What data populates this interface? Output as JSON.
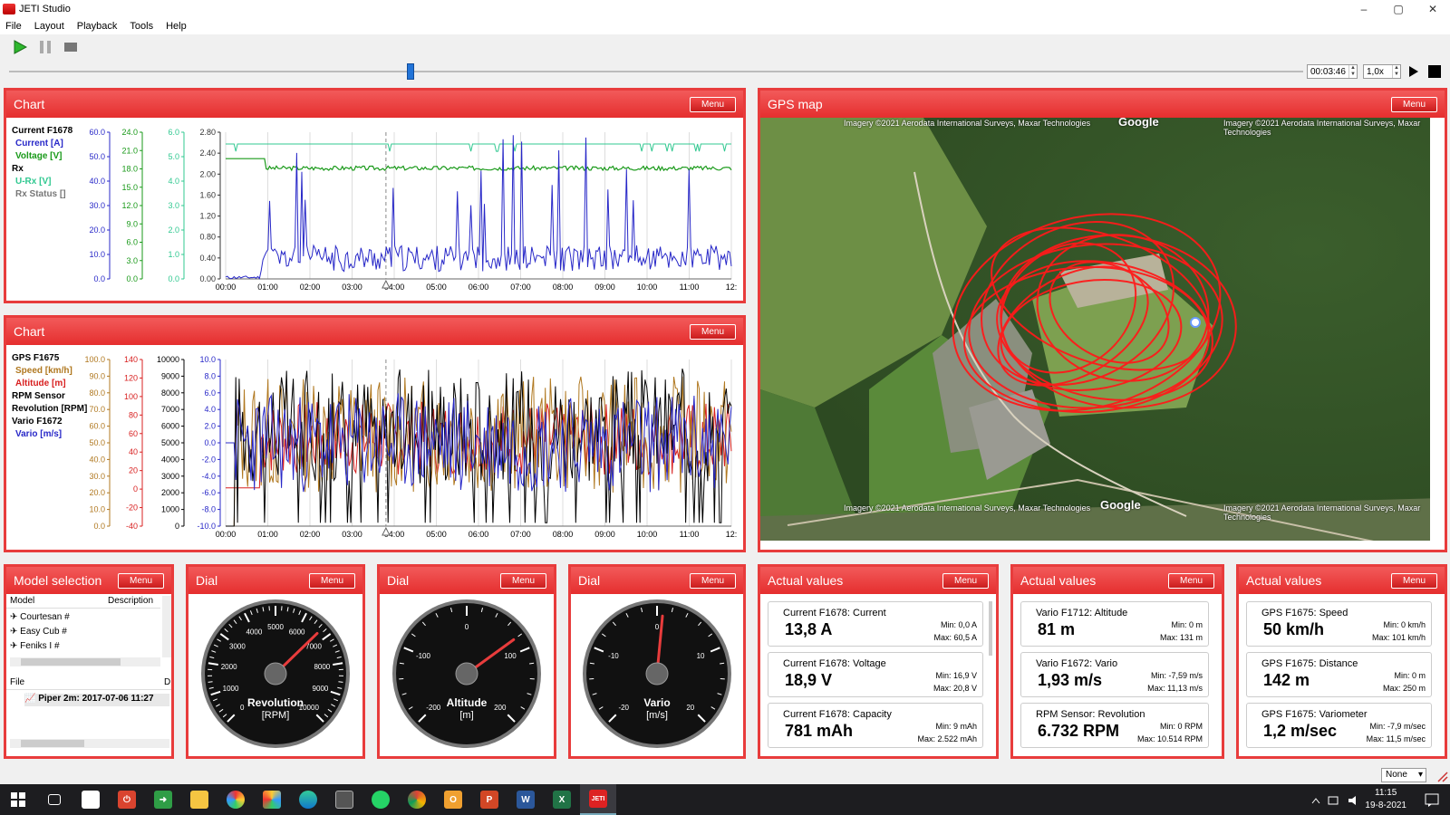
{
  "window": {
    "title": "JETI Studio",
    "min": "–",
    "max": "▢",
    "close": "✕"
  },
  "menu": [
    "File",
    "Layout",
    "Playback",
    "Tools",
    "Help"
  ],
  "playback": {
    "time": "00:03:46",
    "speed": "1,0x",
    "position": 0.31
  },
  "chart1": {
    "title": "Chart",
    "menu": "Menu",
    "legend": [
      {
        "text": "Current F1678",
        "color": "#000000"
      },
      {
        "text": "Current [A]",
        "color": "#2828c8"
      },
      {
        "text": "Voltage [V]",
        "color": "#1a9a1a"
      },
      {
        "text": "Rx",
        "color": "#000000"
      },
      {
        "text": "U-Rx [V]",
        "color": "#30c890"
      },
      {
        "text": "Rx Status []",
        "color": "#777777"
      }
    ],
    "axes": [
      {
        "ticks": [
          "60.0",
          "50.0",
          "40.0",
          "30.0",
          "20.0",
          "10.0",
          "0.0"
        ],
        "color": "#2828c8"
      },
      {
        "ticks": [
          "24.0",
          "21.0",
          "18.0",
          "15.0",
          "12.0",
          "9.0",
          "6.0",
          "3.0",
          "0.0"
        ],
        "color": "#1a9a1a"
      },
      {
        "ticks": [
          "6.0",
          "5.0",
          "4.0",
          "3.0",
          "2.0",
          "1.0",
          "0.0"
        ],
        "color": "#30c890"
      },
      {
        "ticks": [
          "2.80",
          "2.40",
          "2.00",
          "1.60",
          "1.20",
          "0.80",
          "0.40",
          "0.00"
        ],
        "color": "#333333"
      }
    ],
    "xticks": [
      "00:00",
      "01:00",
      "02:00",
      "03:00",
      "04:00",
      "05:00",
      "06:00",
      "07:00",
      "08:00",
      "09:00",
      "10:00",
      "11:00",
      "12:"
    ]
  },
  "chart2": {
    "title": "Chart",
    "menu": "Menu",
    "legend": [
      {
        "text": "GPS F1675",
        "color": "#000000"
      },
      {
        "text": "Speed [km/h]",
        "color": "#b07820"
      },
      {
        "text": "Altitude [m]",
        "color": "#d82020"
      },
      {
        "text": "RPM Sensor",
        "color": "#000000"
      },
      {
        "text": "Revolution [RPM]",
        "color": "#000000"
      },
      {
        "text": "Vario F1672",
        "color": "#000000"
      },
      {
        "text": "Vario [m/s]",
        "color": "#2828c8"
      }
    ],
    "axes": [
      {
        "ticks": [
          "100.0",
          "90.0",
          "80.0",
          "70.0",
          "60.0",
          "50.0",
          "40.0",
          "30.0",
          "20.0",
          "10.0",
          "0.0"
        ],
        "color": "#b07820"
      },
      {
        "ticks": [
          "140",
          "120",
          "100",
          "80",
          "60",
          "40",
          "20",
          "0",
          "-20",
          "-40"
        ],
        "color": "#d82020"
      },
      {
        "ticks": [
          "10000",
          "9000",
          "8000",
          "7000",
          "6000",
          "5000",
          "4000",
          "3000",
          "2000",
          "1000",
          "0"
        ],
        "color": "#000000"
      },
      {
        "ticks": [
          "10.0",
          "8.0",
          "6.0",
          "4.0",
          "2.0",
          "0.0",
          "-2.0",
          "-4.0",
          "-6.0",
          "-8.0",
          "-10.0"
        ],
        "color": "#2828c8"
      }
    ],
    "xticks": [
      "00:00",
      "01:00",
      "02:00",
      "03:00",
      "04:00",
      "05:00",
      "06:00",
      "07:00",
      "08:00",
      "09:00",
      "10:00",
      "11:00",
      "12:"
    ]
  },
  "gps": {
    "title": "GPS map",
    "menu": "Menu",
    "copyright": "Imagery ©2021 Aerodata International Surveys, Maxar Technologies",
    "logo": "Google"
  },
  "model": {
    "title": "Model selection",
    "menu": "Menu",
    "col_model": "Model",
    "col_desc": "Description",
    "items": [
      "Courtesan #",
      "Easy Cub #",
      "Feniks I #"
    ],
    "file_header": "File",
    "file_col2": "D",
    "file_item": "Piper 2m: 2017-07-06 11:27"
  },
  "dials": [
    {
      "title": "Dial",
      "menu": "Menu",
      "label": "Revolution",
      "unit": "[RPM]",
      "ticks": [
        "0",
        "1000",
        "2000",
        "3000",
        "4000",
        "5000",
        "6000",
        "7000",
        "8000",
        "9000",
        "10000"
      ],
      "value": 0.67
    },
    {
      "title": "Dial",
      "menu": "Menu",
      "label": "Altitude",
      "unit": "[m]",
      "ticks": [
        "-200",
        "-100",
        "0",
        "100",
        "200"
      ],
      "value": 0.7
    },
    {
      "title": "Dial",
      "menu": "Menu",
      "label": "Vario",
      "unit": "[m/s]",
      "ticks": [
        "-20",
        "-10",
        "0",
        "10",
        "20"
      ],
      "value": 0.52
    }
  ],
  "actual": [
    {
      "title": "Actual values",
      "menu": "Menu",
      "items": [
        {
          "label": "Current F1678: Current",
          "value": "13,8 A",
          "min": "Min: 0,0 A",
          "max": "Max: 60,5 A"
        },
        {
          "label": "Current F1678: Voltage",
          "value": "18,9 V",
          "min": "Min: 16,9 V",
          "max": "Max: 20,8 V"
        },
        {
          "label": "Current F1678: Capacity",
          "value": "781 mAh",
          "min": "Min: 9 mAh",
          "max": "Max: 2.522 mAh"
        }
      ]
    },
    {
      "title": "Actual values",
      "menu": "Menu",
      "items": [
        {
          "label": "Vario F1712: Altitude",
          "value": "81 m",
          "min": "Min: 0 m",
          "max": "Max: 131 m"
        },
        {
          "label": "Vario F1672: Vario",
          "value": "1,93 m/s",
          "min": "Min: -7,59 m/s",
          "max": "Max: 11,13 m/s"
        },
        {
          "label": "RPM Sensor: Revolution",
          "value": "6.732 RPM",
          "min": "Min: 0 RPM",
          "max": "Max: 10.514 RPM"
        }
      ]
    },
    {
      "title": "Actual values",
      "menu": "Menu",
      "items": [
        {
          "label": "GPS F1675: Speed",
          "value": "50 km/h",
          "min": "Min: 0 km/h",
          "max": "Max: 101 km/h"
        },
        {
          "label": "GPS F1675: Distance",
          "value": "142 m",
          "min": "Min: 0 m",
          "max": "Max: 250 m"
        },
        {
          "label": "GPS F1675: Variometer",
          "value": "1,2 m/sec",
          "min": "Min: -7,9 m/sec",
          "max": "Max: 11,5 m/sec"
        }
      ]
    }
  ],
  "status": {
    "select": "None"
  },
  "taskbar": {
    "time": "11:15",
    "date": "19-8-2021"
  }
}
